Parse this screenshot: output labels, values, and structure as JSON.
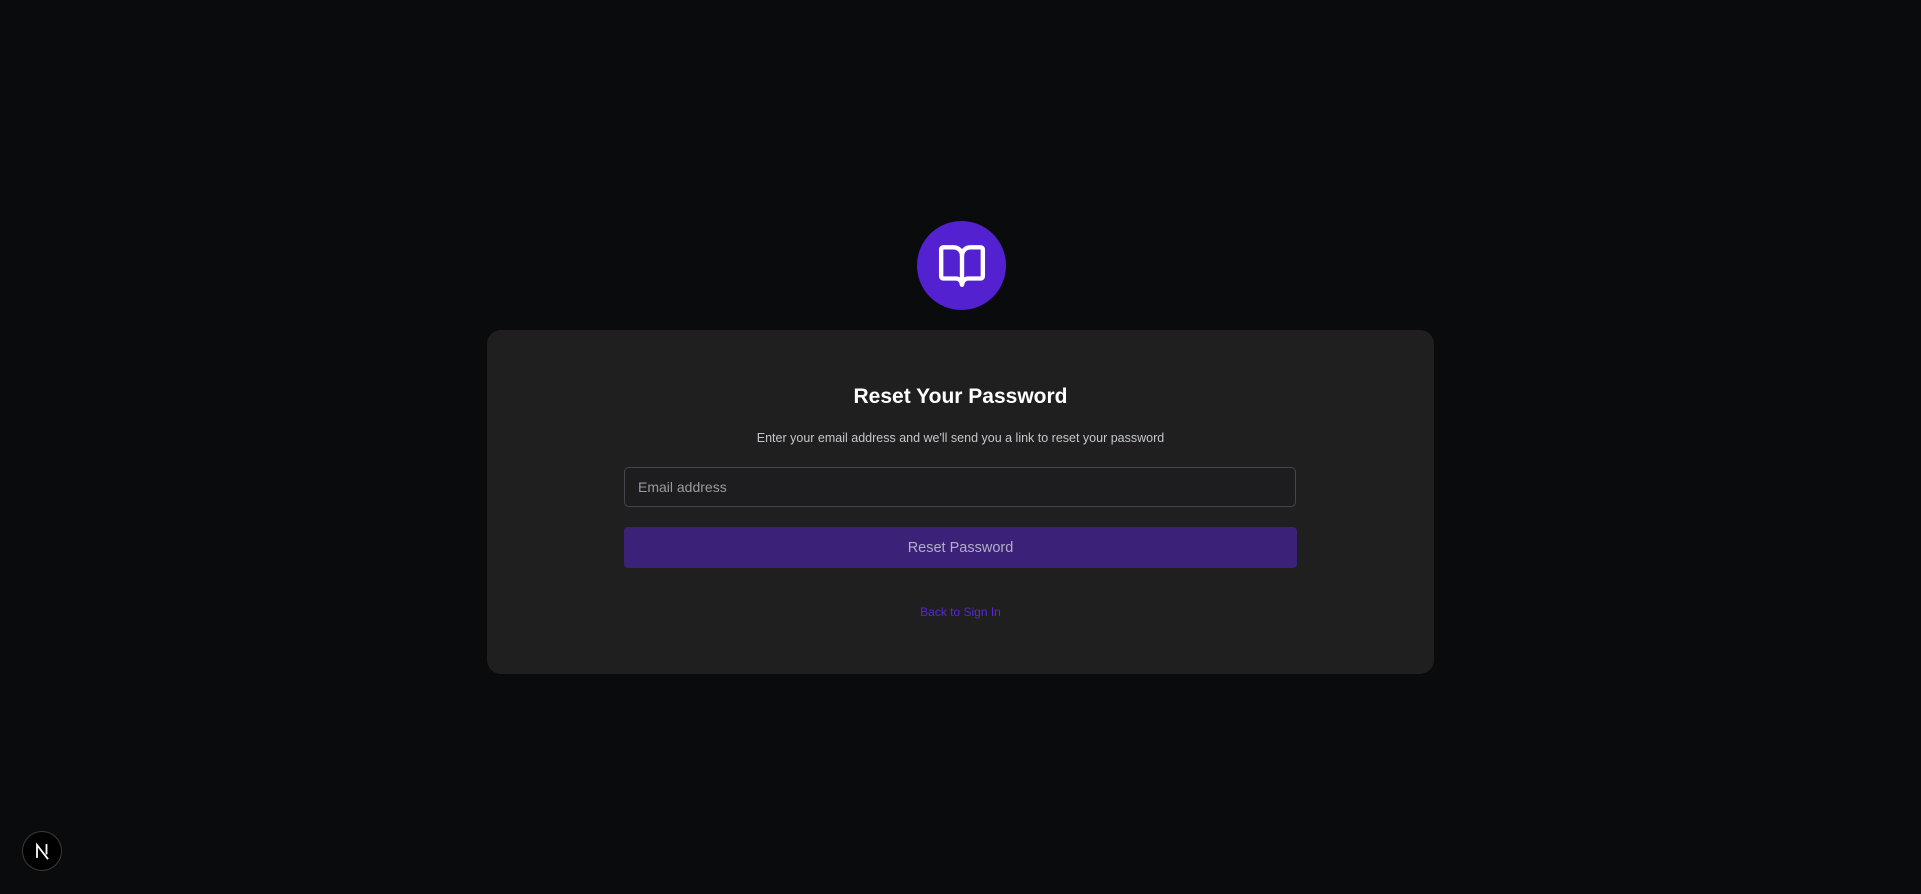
{
  "colors": {
    "background": "#0a0b0d",
    "card": "#1f1f1f",
    "accent": "#5321d0",
    "button": "#3b2177",
    "link": "#5a24de"
  },
  "logo": {
    "icon": "open-book-icon"
  },
  "reset_form": {
    "title": "Reset Your Password",
    "subtitle": "Enter your email address and we'll send you a link to reset your password",
    "email": {
      "value": "",
      "placeholder": "Email address"
    },
    "submit_label": "Reset Password",
    "back_link_label": "Back to Sign In"
  },
  "dev_badge": {
    "icon": "nextjs-icon",
    "letter": "N"
  }
}
